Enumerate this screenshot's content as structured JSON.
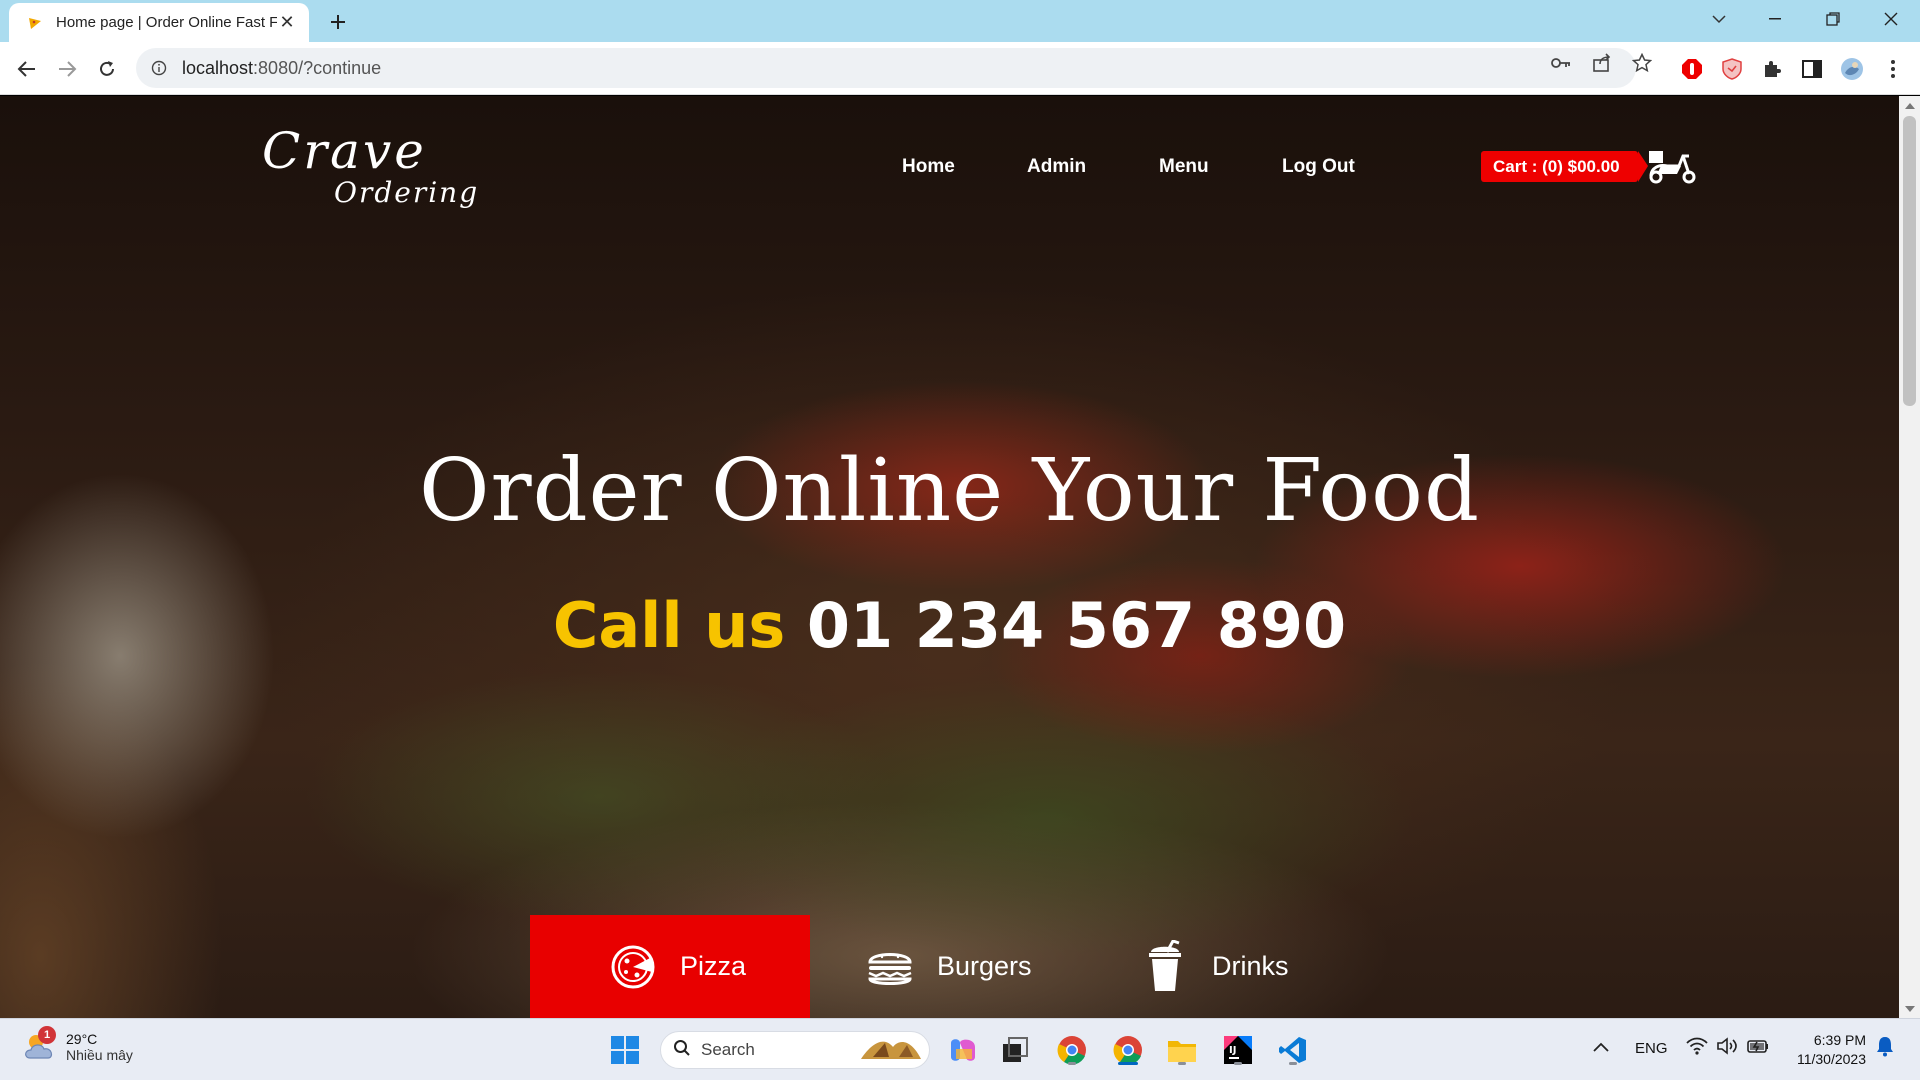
{
  "browser": {
    "tab_title": "Home page | Order Online Fast F",
    "url_host": "localhost",
    "url_rest": ":8080/?continue"
  },
  "site": {
    "logo_line1": "Crave",
    "logo_line2": "Ordering",
    "nav": [
      "Home",
      "Admin",
      "Menu",
      "Log Out"
    ],
    "cart_label": "Cart : (0) $00.00",
    "hero_title": "Order Online Your Food",
    "call_label": "Call us",
    "call_number": "01 234 567 890",
    "categories": [
      {
        "label": "Pizza",
        "icon": "pizza-icon",
        "active": true
      },
      {
        "label": "Burgers",
        "icon": "burger-icon",
        "active": false
      },
      {
        "label": "Drinks",
        "icon": "drink-icon",
        "active": false
      }
    ],
    "accent_color": "#e80000",
    "call_color": "#f7c300"
  },
  "taskbar": {
    "weather_temp": "29°C",
    "weather_desc": "Nhiều mây",
    "weather_badge": "1",
    "search_label": "Search",
    "language": "ENG",
    "time": "6:39 PM",
    "date": "11/30/2023"
  }
}
